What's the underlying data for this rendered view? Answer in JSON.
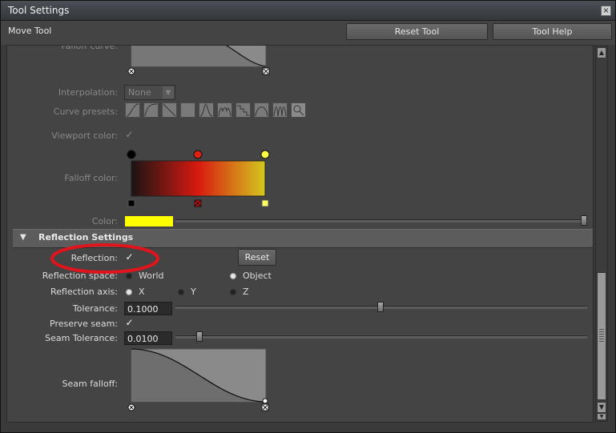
{
  "window": {
    "title": "Tool Settings",
    "close_glyph": "×"
  },
  "toolbar": {
    "tool_name": "Move Tool",
    "reset_tool_label": "Reset Tool",
    "tool_help_label": "Tool Help"
  },
  "falloff": {
    "curve_label": "Falloff curve:",
    "interpolation_label": "Interpolation:",
    "interpolation_value": "None",
    "curve_presets_label": "Curve presets:",
    "viewport_color_label": "Viewport color:",
    "falloff_color_label": "Falloff color:",
    "color_label": "Color:"
  },
  "reflection": {
    "section_title": "Reflection Settings",
    "reflection_label": "Reflection:",
    "reset_label": "Reset",
    "space_label": "Reflection space:",
    "space_options": [
      "World",
      "Object"
    ],
    "space_selected": "Object",
    "axis_label": "Reflection axis:",
    "axis_options": [
      "X",
      "Y",
      "Z"
    ],
    "axis_selected": "X",
    "tolerance_label": "Tolerance:",
    "tolerance_value": "0.1000",
    "preserve_seam_label": "Preserve seam:",
    "seam_tolerance_label": "Seam Tolerance:",
    "seam_tolerance_value": "0.0100",
    "seam_falloff_label": "Seam falloff:"
  },
  "glyphs": {
    "check": "✓"
  },
  "colors": {
    "accent_yellow": "#ffff00",
    "annotation_red": "#e0141c"
  }
}
